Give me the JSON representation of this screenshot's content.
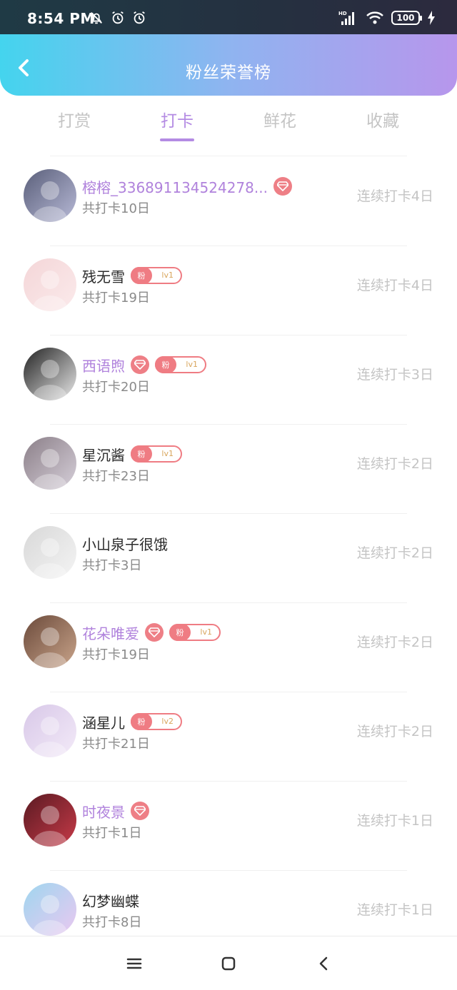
{
  "status": {
    "time": "8:54 PM",
    "battery": "100",
    "hd_label": "HD"
  },
  "header": {
    "title": "粉丝荣誉榜"
  },
  "tabs": [
    {
      "label": "打赏",
      "active": false
    },
    {
      "label": "打卡",
      "active": true
    },
    {
      "label": "鲜花",
      "active": false
    },
    {
      "label": "收藏",
      "active": false
    }
  ],
  "badge": {
    "fan_label": "粉"
  },
  "entries": [
    {
      "name": "榕榕_336891134524278...",
      "vip": true,
      "gem": true,
      "fan_level": null,
      "total": "共打卡10日",
      "streak": "连续打卡4日"
    },
    {
      "name": "残无雪",
      "vip": false,
      "gem": false,
      "fan_level": "lv1",
      "total": "共打卡19日",
      "streak": "连续打卡4日"
    },
    {
      "name": "西语煦",
      "vip": true,
      "gem": true,
      "fan_level": "lv1",
      "total": "共打卡20日",
      "streak": "连续打卡3日"
    },
    {
      "name": "星沉酱",
      "vip": false,
      "gem": false,
      "fan_level": "lv1",
      "total": "共打卡23日",
      "streak": "连续打卡2日"
    },
    {
      "name": "小山泉子很饿",
      "vip": false,
      "gem": false,
      "fan_level": null,
      "total": "共打卡3日",
      "streak": "连续打卡2日"
    },
    {
      "name": "花朵唯爱",
      "vip": true,
      "gem": true,
      "fan_level": "lv1",
      "total": "共打卡19日",
      "streak": "连续打卡2日"
    },
    {
      "name": "涵星儿",
      "vip": false,
      "gem": false,
      "fan_level": "lv2",
      "total": "共打卡21日",
      "streak": "连续打卡2日"
    },
    {
      "name": "时夜景",
      "vip": true,
      "gem": true,
      "fan_level": null,
      "total": "共打卡1日",
      "streak": "连续打卡1日"
    },
    {
      "name": "幻梦幽蝶",
      "vip": false,
      "gem": false,
      "fan_level": null,
      "total": "共打卡8日",
      "streak": "连续打卡1日"
    }
  ],
  "colors": {
    "accent": "#b48be3",
    "vip_name": "#b082dc",
    "badge": "#ef7c83",
    "muted": "#c4c4c4"
  }
}
